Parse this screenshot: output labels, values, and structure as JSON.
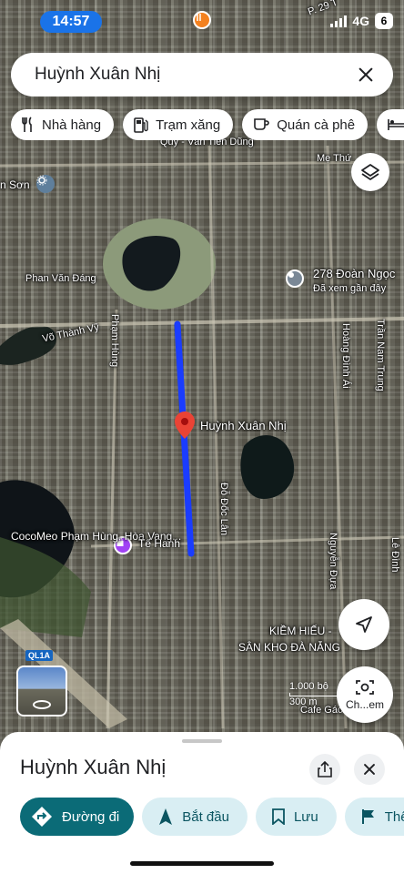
{
  "status_bar": {
    "time": "14:57",
    "network": "4G",
    "battery": "6"
  },
  "search": {
    "query": "Huỳnh Xuân Nhị",
    "close_icon": "close-icon"
  },
  "chips": [
    {
      "label": "Nhà hàng",
      "icon": "fork-knife-icon"
    },
    {
      "label": "Trạm xăng",
      "icon": "gas-station-icon"
    },
    {
      "label": "Quán cà phê",
      "icon": "coffee-cup-icon"
    },
    {
      "label": "Kh",
      "icon": "bed-icon"
    }
  ],
  "map": {
    "selected_street": "Huỳnh Xuân Nhị",
    "labels": {
      "nearby_poi": "278 Đoàn Ngọc",
      "nearby_poi_sub": "Đã xem gần đây",
      "phan_van_dang": "Phan Văn Đáng",
      "vo_thanh_vy": "Võ Thành Vỹ",
      "pham_hung": "Phạm Hùng",
      "cocomeo": "CocoMeo Phạm Hùng, Hòa Vang...",
      "te_hanh": "Tế Hanh",
      "do_doc_lan": "Đỗ Đốc Lân",
      "hoang_dinh_ai": "Hoàng Đình Ái",
      "tran_nam_trung": "Trần Nam Trung",
      "nguyen_dua": "Nguyễn Đựa",
      "le_dinh": "Lê Đình",
      "kiem_hieu": "KIỀM HIẾU -",
      "san_kho": "SÂN KHO ĐÀ NẴNG",
      "me_thu": "Mẹ Thứ",
      "quy_van_tien_dung": "Quy - Văn Tiến Dũng",
      "n_son": "n Sơn",
      "ql1a": "QL1A",
      "cafe_gac": "Cafe Gác",
      "p29": "P. 29 T"
    },
    "scale": {
      "imperial": "1.000 bộ",
      "metric": "300 m"
    }
  },
  "buttons": {
    "layers_icon": "layers-icon",
    "navigate_icon": "navigation-arrow-icon",
    "lens_label": "Ch...em"
  },
  "sheet": {
    "title": "Huỳnh Xuân Nhị",
    "actions": [
      {
        "label": "Đường đi",
        "icon": "directions-icon"
      },
      {
        "label": "Bắt đầu",
        "icon": "navigation-arrow-icon"
      },
      {
        "label": "Lưu",
        "icon": "bookmark-icon"
      },
      {
        "label": "Thê",
        "icon": "flag-icon"
      }
    ]
  },
  "colors": {
    "route": "#1a3cff",
    "pin": "#ea4335",
    "accent": "#1a73e8",
    "primary_action": "#0b6b77",
    "action_bg": "#d9eef3"
  }
}
